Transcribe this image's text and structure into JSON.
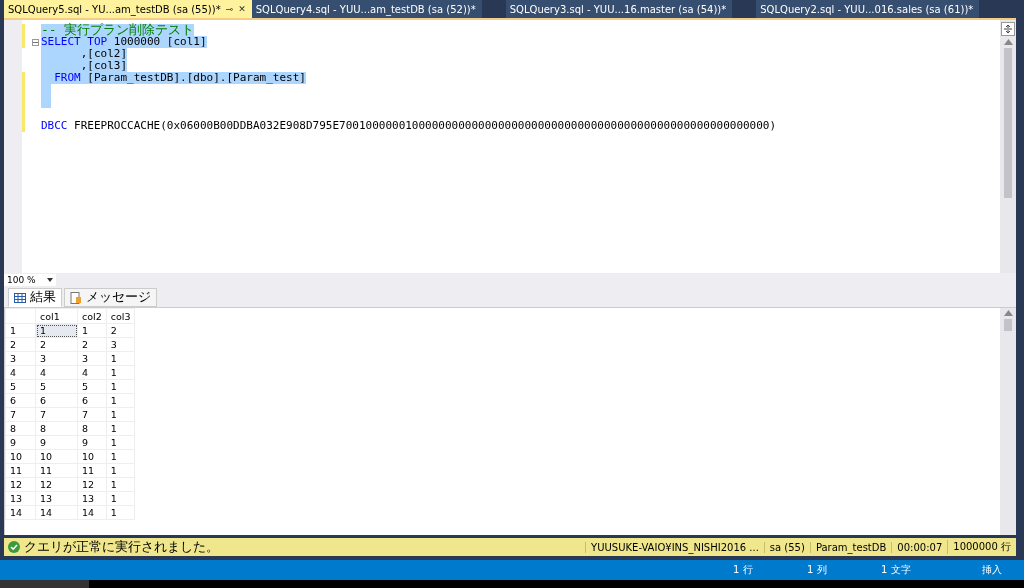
{
  "tabs": [
    {
      "label": "SQLQuery5.sql - YU...am_testDB (sa (55))*",
      "selected": true,
      "pin": "⊸",
      "close": "✕"
    },
    {
      "label": "SQLQuery4.sql - YUU...am_testDB (sa (52))*",
      "selected": false
    },
    {
      "label": "SQLQuery3.sql - YUU...16.master (sa (54))*",
      "selected": false
    },
    {
      "label": "SQLQuery2.sql - YUU...016.sales (sa (61))*",
      "selected": false
    }
  ],
  "editor": {
    "lines": [
      {
        "changed": true,
        "selected": true,
        "tokens": [
          {
            "kind": "comment",
            "text": "-- 実行プラン削除テスト"
          }
        ]
      },
      {
        "changed": true,
        "selected": true,
        "collapse": true,
        "tokens": [
          {
            "kind": "keyword",
            "text": "SELECT TOP"
          },
          {
            "kind": "plain",
            "text": " 1000000 [col1]"
          }
        ]
      },
      {
        "changed": false,
        "selected": true,
        "tokens": [
          {
            "kind": "plain",
            "text": "      ,[col2]"
          }
        ]
      },
      {
        "changed": false,
        "selected": true,
        "tokens": [
          {
            "kind": "plain",
            "text": "      ,[col3]"
          }
        ]
      },
      {
        "changed": true,
        "selected": true,
        "tokens": [
          {
            "kind": "keyword",
            "text": "  FROM"
          },
          {
            "kind": "plain",
            "text": " [Param_testDB].[dbo].[Param_test]"
          }
        ]
      },
      {
        "changed": true,
        "selected": true
      },
      {
        "changed": true,
        "selected": true
      },
      {
        "changed": true,
        "selected": false
      },
      {
        "changed": true,
        "selected": false,
        "tokens": [
          {
            "kind": "keyword",
            "text": "DBCC"
          },
          {
            "kind": "plain",
            "text": " FREEPROCCACHE(0x06000B00DDBA032E908D795E70010000001000000000000000000000000000000000000000000000000000000)"
          }
        ]
      }
    ],
    "zoom": "100 %"
  },
  "result_tabs": [
    {
      "label": "結果",
      "selected": true,
      "kind": "grid"
    },
    {
      "label": "メッセージ",
      "selected": false,
      "kind": "message"
    }
  ],
  "table": {
    "columns": [
      "",
      "col1",
      "col2",
      "col3"
    ],
    "rows": [
      [
        "1",
        "1",
        "1",
        "2"
      ],
      [
        "2",
        "2",
        "2",
        "3"
      ],
      [
        "3",
        "3",
        "3",
        "1"
      ],
      [
        "4",
        "4",
        "4",
        "1"
      ],
      [
        "5",
        "5",
        "5",
        "1"
      ],
      [
        "6",
        "6",
        "6",
        "1"
      ],
      [
        "7",
        "7",
        "7",
        "1"
      ],
      [
        "8",
        "8",
        "8",
        "1"
      ],
      [
        "9",
        "9",
        "9",
        "1"
      ],
      [
        "10",
        "10",
        "10",
        "1"
      ],
      [
        "11",
        "11",
        "11",
        "1"
      ],
      [
        "12",
        "12",
        "12",
        "1"
      ],
      [
        "13",
        "13",
        "13",
        "1"
      ],
      [
        "14",
        "14",
        "14",
        "1"
      ]
    ]
  },
  "query_status": {
    "message": "クエリが正常に実行されました。",
    "fields": [
      "YUUSUKE-VAIO¥INS_NISHI2016 ...",
      "sa (55)",
      "Param_testDB",
      "00:00:07",
      "1000000 行"
    ]
  },
  "status_bar": [
    "1 行",
    "1 列",
    "1 文字",
    "挿入"
  ]
}
